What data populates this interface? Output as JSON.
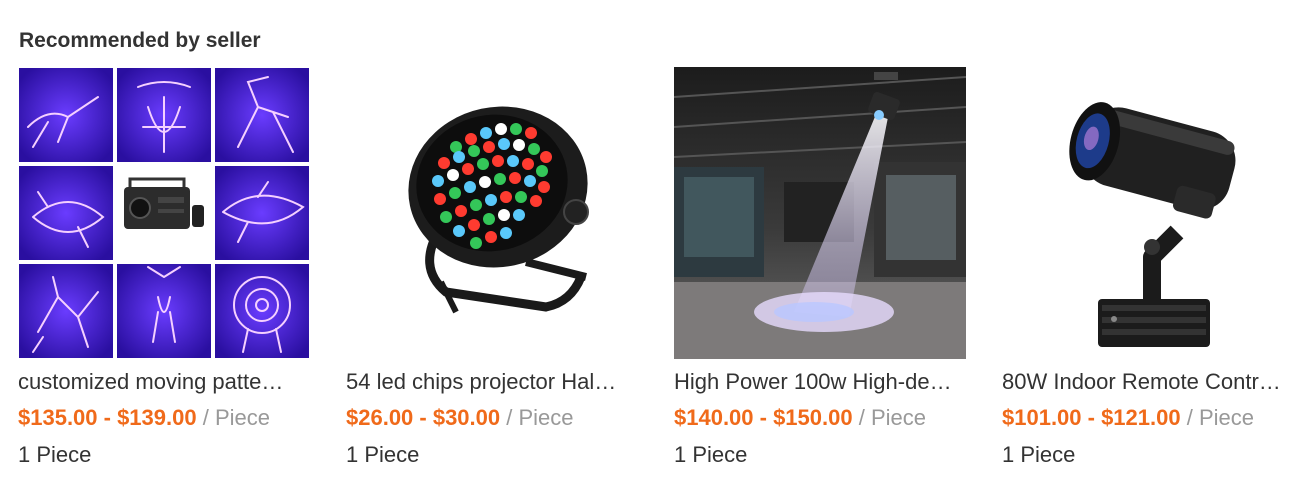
{
  "section": {
    "title": "Recommended by seller"
  },
  "products": [
    {
      "image_icon": "laser-light-projector-icon",
      "title": "customized moving patte…",
      "price": "$135.00 - $139.00",
      "unit": "/ Piece",
      "moq": "1 Piece"
    },
    {
      "image_icon": "led-par-light-icon",
      "title": "54 led chips projector Hal…",
      "price": "$26.00 - $30.00",
      "unit": "/ Piece",
      "moq": "1 Piece"
    },
    {
      "image_icon": "gobo-projector-scene-icon",
      "title": "High Power 100w High-de…",
      "price": "$140.00 - $150.00",
      "unit": "/ Piece",
      "moq": "1 Piece"
    },
    {
      "image_icon": "gobo-projector-device-icon",
      "title": "80W Indoor Remote Contr…",
      "price": "$101.00 - $121.00",
      "unit": "/ Piece",
      "moq": "1 Piece"
    }
  ],
  "colors": {
    "price": "#f06a1a",
    "unit": "#999999",
    "text": "#333333"
  }
}
